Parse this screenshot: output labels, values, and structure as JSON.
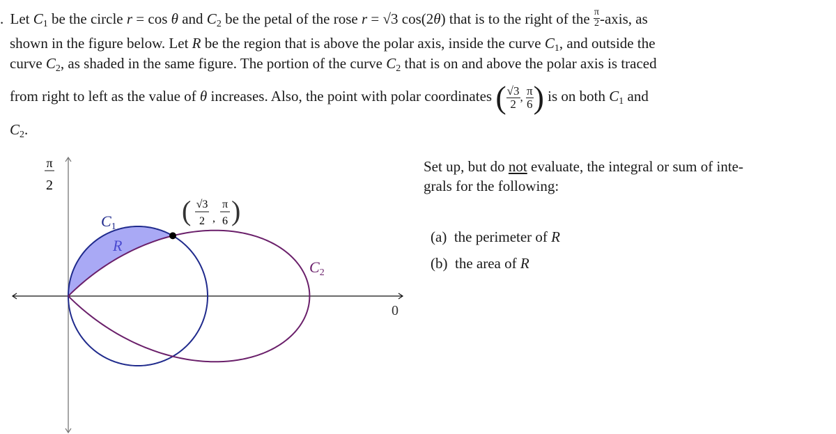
{
  "problem": {
    "marker": ".",
    "line1": {
      "a": "Let ",
      "c1": "C",
      "c1_sub": "1",
      "b": " be the circle ",
      "r": "r",
      "eq1": " = cos ",
      "theta": "θ",
      "c": " and ",
      "c2": "C",
      "c2_sub": "2",
      "d": " be the petal of the rose ",
      "r2": "r",
      "eq2": " = √3 cos(2",
      "theta2": "θ",
      "eq2_end": ")",
      "e": " that is to the right of the ",
      "axis_num": "π",
      "axis_den": "2",
      "f": "-axis, as"
    },
    "line2": {
      "a": "shown in the figure below.  Let ",
      "R": "R",
      "b": " be the region that is above the polar axis, inside the curve ",
      "c1": "C",
      "c1_sub": "1",
      "c": ", and outside the"
    },
    "line3": {
      "a": "curve ",
      "c2": "C",
      "c2_sub": "2",
      "b": ", as shaded in the same figure.  The portion of the curve ",
      "c2b": "C",
      "c2b_sub": "2",
      "c": " that is on and above the polar axis is traced"
    },
    "line4": {
      "a": "from right to left as the value of ",
      "theta": "θ",
      "b": " increases.  Also, the point with polar coordinates ",
      "pt_r_num": "√3",
      "pt_r_den": "2",
      "pt_t_num": "π",
      "pt_t_den": "6",
      "c": " is on both ",
      "c1": "C",
      "c1_sub": "1",
      "d": " and"
    },
    "line5": {
      "c2": "C",
      "c2_sub": "2",
      "end": "."
    }
  },
  "instructions": {
    "line1": "Set up, but do ",
    "not": "not",
    "line1_end": " evaluate, the integral or sum of inte-",
    "line2": "grals for the following:",
    "parts": [
      {
        "label": "(a)",
        "text": "the perimeter of ",
        "var": "R"
      },
      {
        "label": "(b)",
        "text": "the area of ",
        "var": "R"
      }
    ]
  },
  "figure": {
    "axis_label_top_num": "π",
    "axis_label_top_den": "2",
    "axis_label_right": "0",
    "curve1_label": "C",
    "curve1_sub": "1",
    "curve2_label": "C",
    "curve2_sub": "2",
    "region_label": "R",
    "point_label_r_num": "√3",
    "point_label_r_den": "2",
    "point_label_t_num": "π",
    "point_label_t_den": "6",
    "colors": {
      "circle": "#1f2a8c",
      "rose": "#6a1f6a",
      "shade": "#a9a9f5",
      "region_label": "#4a4ad0",
      "axis": "#111111",
      "vaxis": "#777777"
    }
  },
  "chart_data": {
    "type": "polar",
    "title": "",
    "curves": [
      {
        "name": "C1",
        "equation": "r = cos(theta)",
        "theta_range": [
          "-pi/2",
          "pi/2"
        ]
      },
      {
        "name": "C2",
        "equation": "r = sqrt(3) cos(2 theta)",
        "theta_range": [
          "-pi/4",
          "pi/4"
        ]
      }
    ],
    "intersection_point": {
      "r": 0.866,
      "theta": 0.5236,
      "label": "(√3/2, π/6)"
    },
    "shaded_region": "R: above polar axis, inside C1, outside C2",
    "axis_labels": [
      "π/2",
      "0"
    ]
  }
}
